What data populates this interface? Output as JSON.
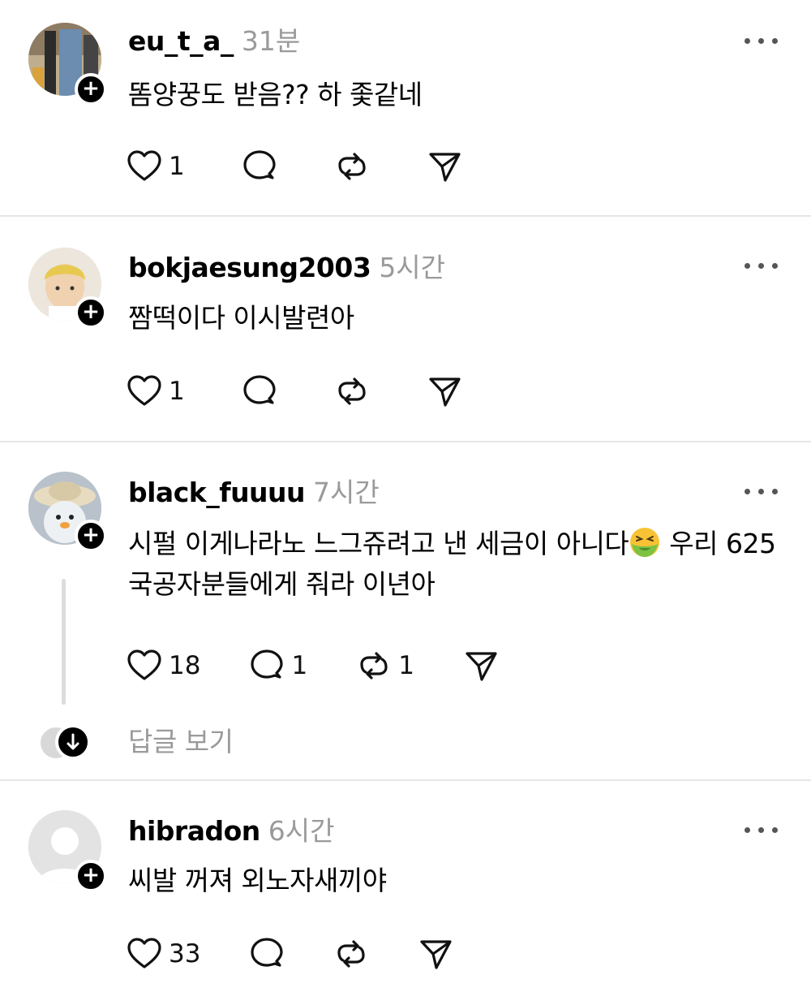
{
  "posts": [
    {
      "username": "eu_t_a_",
      "time": "31분",
      "text": "똠양꿍도 받음?? 하 좇같네",
      "likes": "1",
      "replies": "",
      "reposts": ""
    },
    {
      "username": "bokjaesung2003",
      "time": "5시간",
      "text": "짬떡이다 이시발련아",
      "likes": "1",
      "replies": "",
      "reposts": ""
    },
    {
      "username": "black_fuuuu",
      "time": "7시간",
      "text_before_emoji": "시펄 이게나라노 느그쥬려고 낸 세금이 아니다",
      "text_after_emoji": " 우리 625 국공자분들에게 줘라 이년아",
      "likes": "18",
      "replies": "1",
      "reposts": "1",
      "view_replies_label": "답글 보기"
    },
    {
      "username": "hibradon",
      "time": "6시간",
      "text": "씨발 꺼져 외노자새끼야",
      "likes": "33",
      "replies": "",
      "reposts": ""
    }
  ],
  "follow_symbol": "+",
  "icons": [
    "heart-icon",
    "comment-icon",
    "repost-icon",
    "share-icon",
    "more-icon",
    "nauseated-face-emoji",
    "arrow-down-icon"
  ]
}
